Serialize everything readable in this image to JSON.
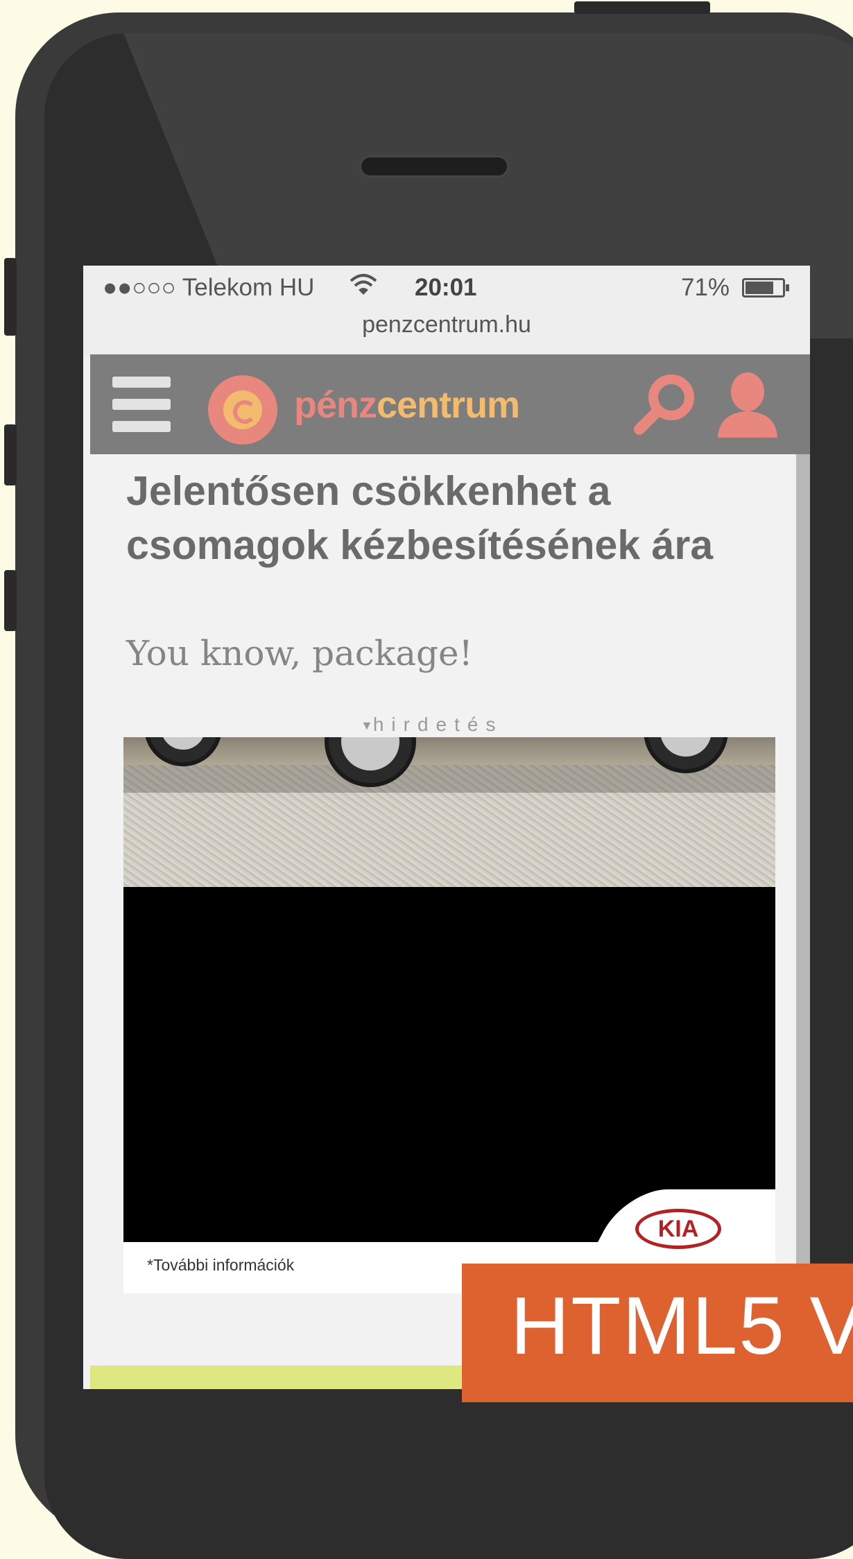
{
  "status_bar": {
    "carrier": "●●○○○ Telekom HU",
    "time": "20:01",
    "battery": "71%",
    "url": "penzcentrum.hu"
  },
  "header": {
    "brand_part1": "pénz",
    "brand_part2": "centrum"
  },
  "article": {
    "headline": "Jelentősen csökkenhet a csomagok kézbesítésének ára",
    "subheadline": "You know, package!"
  },
  "ad": {
    "label": "hirdetés",
    "footnote": "*További információk",
    "brand_logo": "KIA"
  },
  "overlay": {
    "text": "HTML5 V"
  },
  "colors": {
    "brand_red": "#e7877e",
    "brand_orange": "#f2bb6e",
    "navbar": "#7d7d7d",
    "overlay_orange": "#dd6230"
  }
}
